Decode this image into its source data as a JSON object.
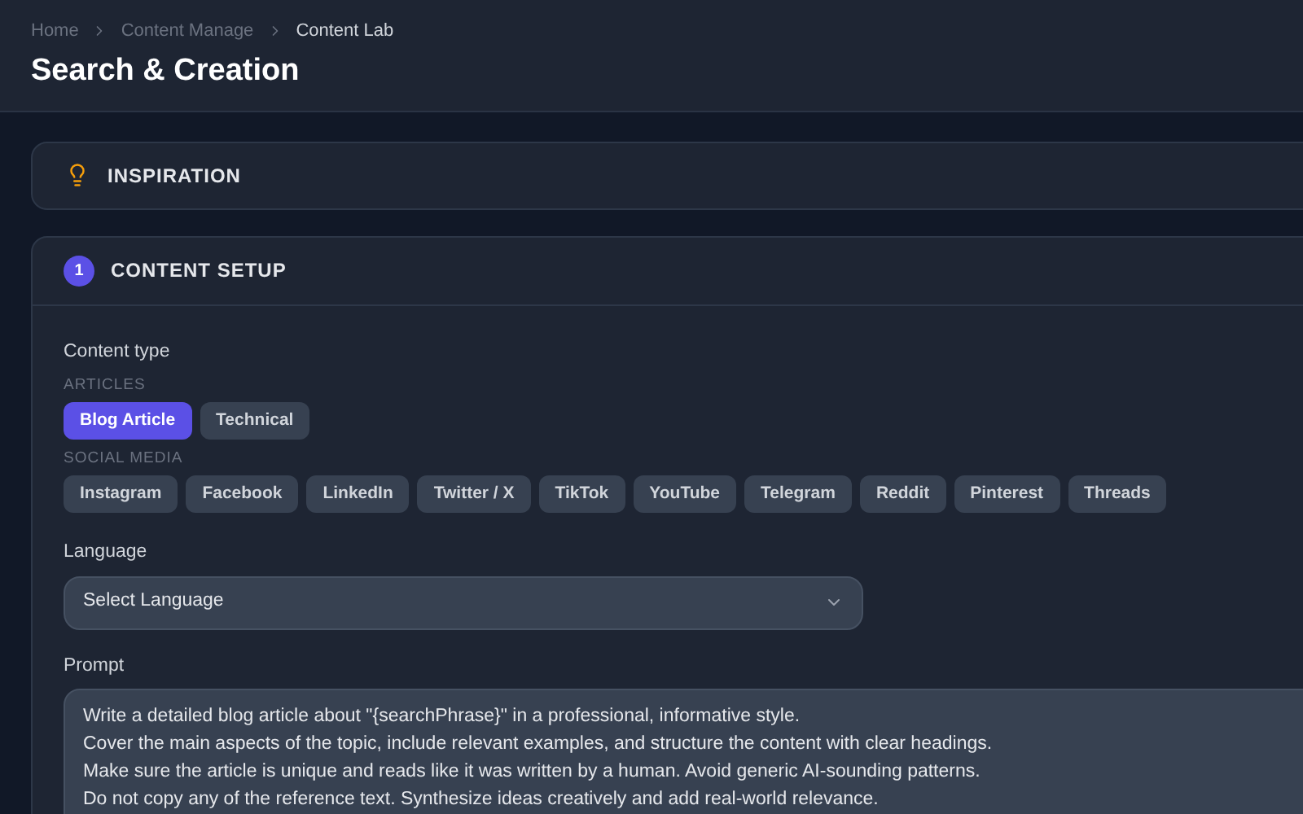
{
  "breadcrumb": [
    {
      "label": "Home",
      "current": false
    },
    {
      "label": "Content Manage",
      "current": false
    },
    {
      "label": "Content Lab",
      "current": true
    }
  ],
  "title": "Search & Creation",
  "inspiration": {
    "title": "INSPIRATION"
  },
  "setup": {
    "step": "1",
    "title": "CONTENT SETUP",
    "content_type": {
      "label": "Content type",
      "groups": [
        {
          "label": "ARTICLES",
          "options": [
            {
              "label": "Blog Article",
              "selected": true
            },
            {
              "label": "Technical",
              "selected": false
            }
          ]
        },
        {
          "label": "SOCIAL MEDIA",
          "options": [
            {
              "label": "Instagram",
              "selected": false
            },
            {
              "label": "Facebook",
              "selected": false
            },
            {
              "label": "LinkedIn",
              "selected": false
            },
            {
              "label": "Twitter / X",
              "selected": false
            },
            {
              "label": "TikTok",
              "selected": false
            },
            {
              "label": "YouTube",
              "selected": false
            },
            {
              "label": "Telegram",
              "selected": false
            },
            {
              "label": "Reddit",
              "selected": false
            },
            {
              "label": "Pinterest",
              "selected": false
            },
            {
              "label": "Threads",
              "selected": false
            }
          ]
        }
      ]
    },
    "language": {
      "label": "Language",
      "placeholder": "Select Language"
    },
    "prompt": {
      "label": "Prompt",
      "value": "Write a detailed blog article about \"{searchPhrase}\" in a professional, informative style.\nCover the main aspects of the topic, include relevant examples, and structure the content with clear headings.\nMake sure the article is unique and reads like it was written by a human. Avoid generic AI-sounding patterns.\nDo not copy any of the reference text. Synthesize ideas creatively and add real-world relevance."
    }
  }
}
